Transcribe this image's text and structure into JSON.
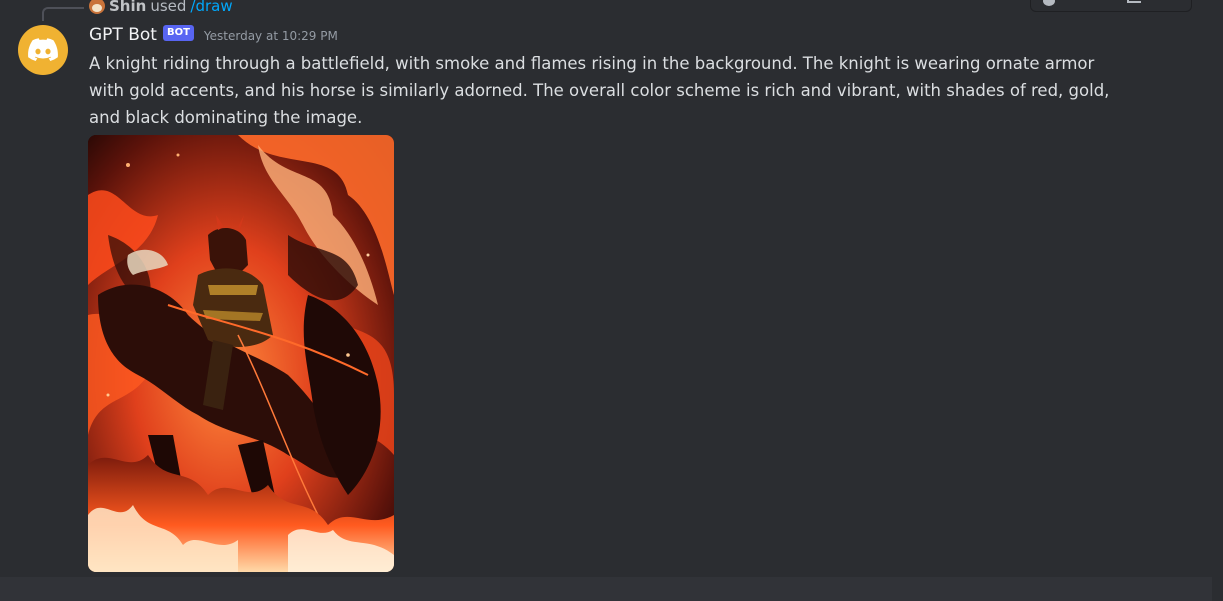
{
  "reply": {
    "user": "Shin",
    "used_text": "used",
    "command": "/draw"
  },
  "message": {
    "author": "GPT Bot",
    "badge": "BOT",
    "timestamp": "Yesterday at 10:29 PM",
    "text": "A knight riding through a battlefield, with smoke and flames rising in the background. The knight is wearing ornate armor with gold accents, and his horse is similarly adorned. The overall color scheme is rich and vibrant, with shades of red, gold, and black dominating the image."
  },
  "icons": {
    "avatar": "discord-logo-icon",
    "reply_avatar": "shiba-avatar-icon"
  },
  "colors": {
    "background": "#2b2d31",
    "avatar_bg": "#f0b232",
    "badge_bg": "#5865f2",
    "command_link": "#00a8fc"
  }
}
